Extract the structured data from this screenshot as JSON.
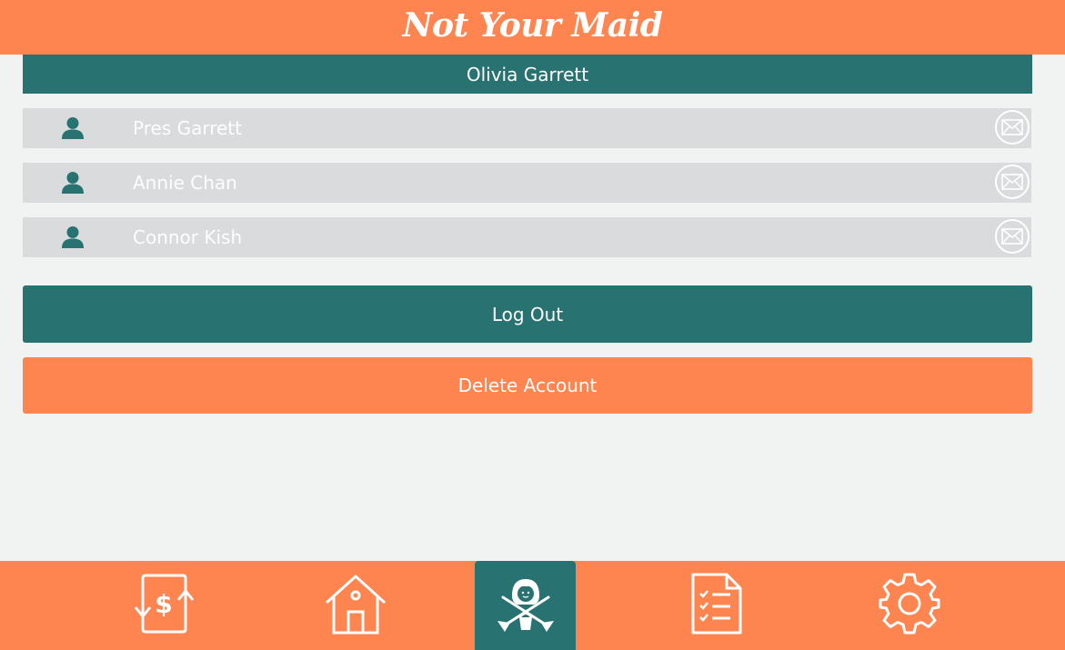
{
  "header": {
    "title": "Not Your Maid"
  },
  "household": {
    "name": "Olivia Garrett"
  },
  "members": [
    {
      "name": "Pres Garrett",
      "icon": "user-icon",
      "action_icon": "mail-icon"
    },
    {
      "name": "Annie Chan",
      "icon": "user-icon",
      "action_icon": "mail-icon"
    },
    {
      "name": "Connor Kish",
      "icon": "user-icon",
      "action_icon": "mail-icon"
    }
  ],
  "actions": {
    "logout_label": "Log Out",
    "delete_label": "Delete Account"
  },
  "nav": {
    "items": [
      {
        "icon": "money-transfer-icon",
        "active": false
      },
      {
        "icon": "home-icon",
        "active": false
      },
      {
        "icon": "maid-profile-icon",
        "active": true
      },
      {
        "icon": "checklist-icon",
        "active": false
      },
      {
        "icon": "gear-icon",
        "active": false
      }
    ]
  },
  "colors": {
    "brand_orange": "#ff8550",
    "teal": "#287372",
    "background": "#f1f3f2",
    "row_gray": "#dadbdd"
  }
}
